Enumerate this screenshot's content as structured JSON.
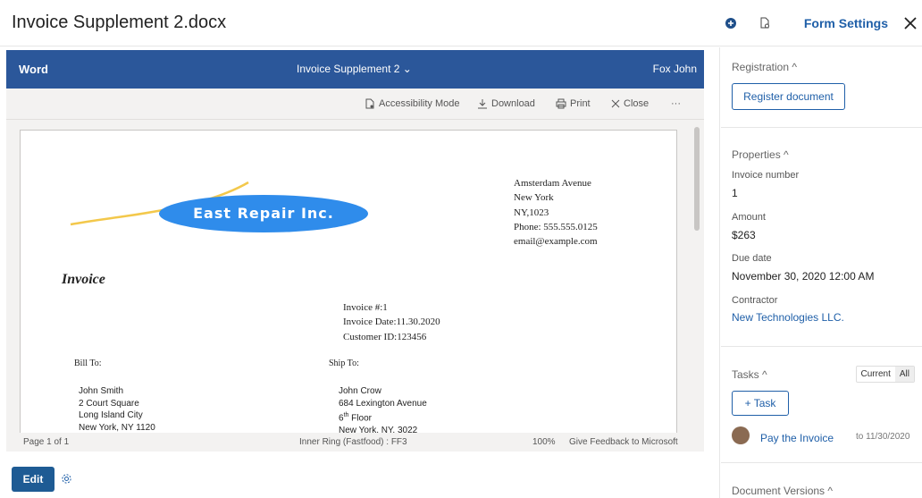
{
  "header": {
    "title": "Invoice Supplement 2.docx",
    "form_settings": "Form Settings",
    "icons": [
      "add-circle-icon",
      "document-settings-icon",
      "close-icon"
    ]
  },
  "viewer": {
    "app_name": "Word",
    "doc_name": "Invoice Supplement 2",
    "user": "Fox John",
    "commands": {
      "accessibility": "Accessibility Mode",
      "download": "Download",
      "print": "Print",
      "close": "Close",
      "more": "···"
    },
    "status": {
      "page": "Page 1 of 1",
      "ring": "Inner Ring (Fastfood) : FF3",
      "zoom": "100%",
      "feedback": "Give Feedback to Microsoft"
    },
    "document": {
      "logo_text": "East Repair Inc.",
      "address": [
        "Amsterdam Avenue",
        "New York",
        "NY,1023",
        "Phone: 555.555.0125",
        "email@example.com"
      ],
      "heading": "Invoice",
      "meta": [
        "Invoice #:1",
        "Invoice Date:11.30.2020",
        "Customer ID:123456"
      ],
      "bill_to_label": "Bill To:",
      "ship_to_label": "Ship To:",
      "bill_to": [
        "John Smith",
        "2 Court Square",
        "Long Island City",
        "New York, NY 1120"
      ],
      "ship_to_name": "John Crow",
      "ship_to_street": "684 Lexington Avenue",
      "ship_to_floor_num": "6",
      "ship_to_floor_sup": "th",
      "ship_to_floor_word": " Floor",
      "ship_to_city": "New York, NY, 3022"
    }
  },
  "footer": {
    "edit_label": "Edit"
  },
  "sidebar": {
    "registration": {
      "title": "Registration ^",
      "button": "Register document"
    },
    "properties": {
      "title": "Properties ^",
      "invoice_number_label": "Invoice number",
      "invoice_number": "1",
      "amount_label": "Amount",
      "amount": "$263",
      "due_date_label": "Due date",
      "due_date": "November 30, 2020 12:00 AM",
      "contractor_label": "Contractor",
      "contractor": "New Technologies LLC."
    },
    "tasks": {
      "title": "Tasks ^",
      "toggle_current": "Current",
      "toggle_all": "All",
      "add_button": "+ Task",
      "items": [
        {
          "name": "Pay the Invoice",
          "due": "to 11/30/2020"
        }
      ]
    },
    "versions": {
      "title": "Document Versions ^"
    }
  },
  "colors": {
    "word_blue": "#2b579a",
    "link_blue": "#1f5fa8",
    "edit_button": "#1e5b94",
    "logo_ellipse": "#2f8ceb",
    "logo_swoosh": "#f3c84b"
  }
}
